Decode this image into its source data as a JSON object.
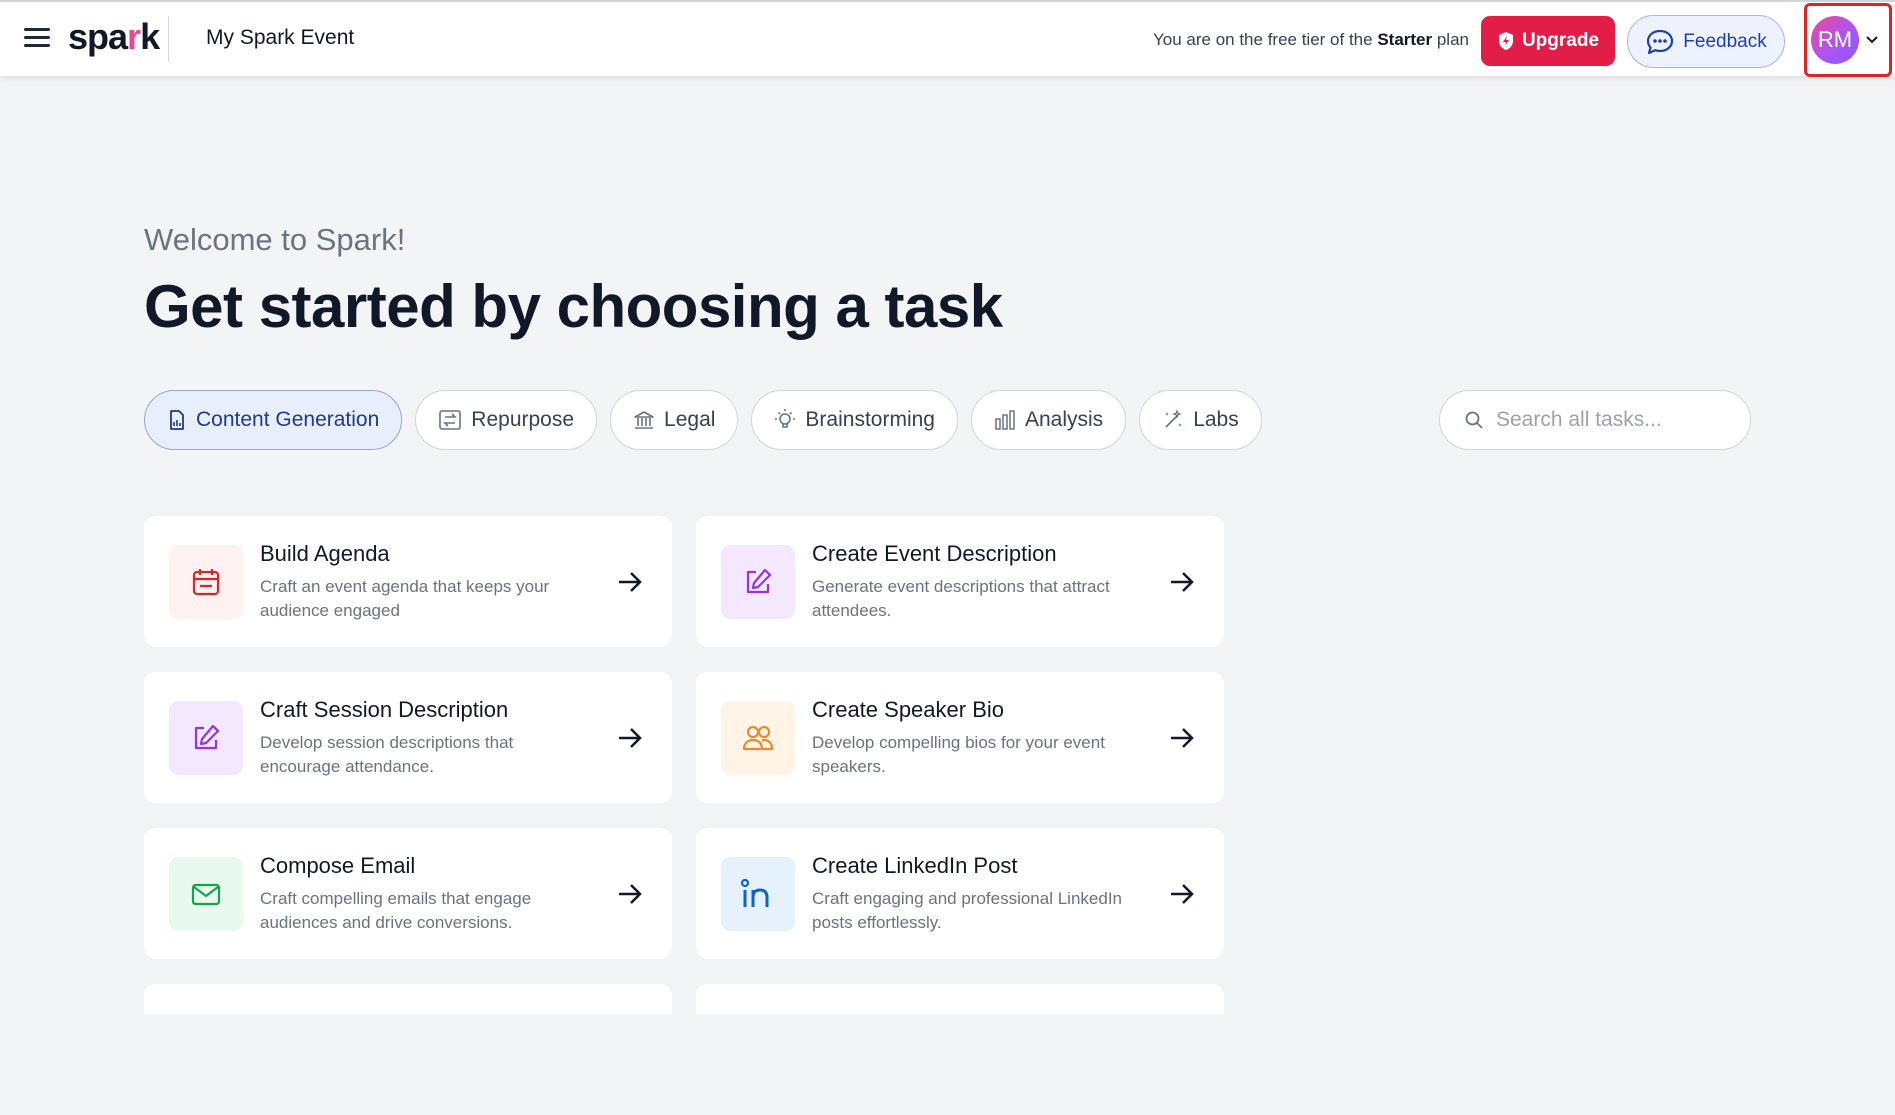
{
  "header": {
    "logo_prefix": "spa",
    "logo_accent": "r",
    "logo_suffix": "k",
    "event_name": "My Spark Event",
    "plan_prefix": "You are on the free tier of the ",
    "plan_name": "Starter",
    "plan_suffix": " plan",
    "upgrade_label": "Upgrade",
    "feedback_label": "Feedback",
    "avatar_initials": "RM"
  },
  "hero": {
    "welcome": "Welcome to Spark!",
    "headline": "Get started by choosing a task"
  },
  "tabs": [
    {
      "label": "Content Generation",
      "icon": "document-icon",
      "active": true
    },
    {
      "label": "Repurpose",
      "icon": "repurpose-icon",
      "active": false
    },
    {
      "label": "Legal",
      "icon": "bank-icon",
      "active": false
    },
    {
      "label": "Brainstorming",
      "icon": "lightbulb-icon",
      "active": false
    },
    {
      "label": "Analysis",
      "icon": "bar-chart-icon",
      "active": false
    },
    {
      "label": "Labs",
      "icon": "magic-wand-icon",
      "active": false
    }
  ],
  "search": {
    "placeholder": "Search all tasks..."
  },
  "cards": [
    {
      "title": "Build Agenda",
      "description": "Craft an event agenda that keeps your audience engaged",
      "icon": "calendar-icon",
      "icon_color": "#dc2626",
      "icon_bg": "#fef2f2"
    },
    {
      "title": "Create Event Description",
      "description": "Generate event descriptions that attract attendees.",
      "icon": "edit-icon",
      "icon_color": "#9333ea",
      "icon_bg": "#f3e8ff"
    },
    {
      "title": "Craft Session Description",
      "description": "Develop session descriptions that encourage attendance.",
      "icon": "edit-icon",
      "icon_color": "#9333ea",
      "icon_bg": "#f3e8ff"
    },
    {
      "title": "Create Speaker Bio",
      "description": "Develop compelling bios for your event speakers.",
      "icon": "users-icon",
      "icon_color": "#ea8a2e",
      "icon_bg": "#fff4e6"
    },
    {
      "title": "Compose Email",
      "description": "Craft compelling emails that engage audiences and drive conversions.",
      "icon": "mail-icon",
      "icon_color": "#16a34a",
      "icon_bg": "#e8f9ef"
    },
    {
      "title": "Create LinkedIn Post",
      "description": "Craft engaging and professional LinkedIn posts effortlessly.",
      "icon": "linkedin-icon",
      "icon_color": "#0a66c2",
      "icon_bg": "#e6f2fb"
    }
  ],
  "colors": {
    "upgrade": "#e11d48",
    "feedback_text": "#1e40af",
    "active_tab_bg": "#e8eefb",
    "user_menu_highlight": "#dc2626"
  }
}
